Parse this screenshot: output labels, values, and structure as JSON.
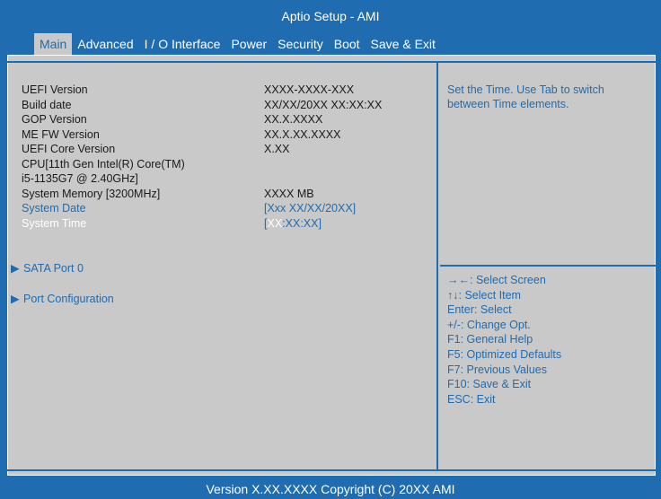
{
  "title": "Aptio Setup - AMI",
  "menu": [
    {
      "label": "Main",
      "active": true
    },
    {
      "label": "Advanced",
      "active": false
    },
    {
      "label": "I / O Interface",
      "active": false
    },
    {
      "label": "Power",
      "active": false
    },
    {
      "label": "Security",
      "active": false
    },
    {
      "label": "Boot",
      "active": false
    },
    {
      "label": "Save & Exit",
      "active": false
    }
  ],
  "info": {
    "uefi_version": {
      "label": "UEFI Version",
      "value": "XXXX-XXXX-XXX"
    },
    "build_date": {
      "label": "Build date",
      "value": "XX/XX/20XX XX:XX:XX"
    },
    "gop_version": {
      "label": "GOP Version",
      "value": "XX.X.XXXX"
    },
    "me_fw_version": {
      "label": "ME FW Version",
      "value": "XX.X.XX.XXXX"
    },
    "uefi_core_version": {
      "label": "UEFI Core Version",
      "value": "X.XX"
    },
    "cpu_line1": "CPU[11th Gen Intel(R) Core(TM)",
    "cpu_line2": "i5-1135G7 @ 2.40GHz]",
    "system_memory": {
      "label": "System Memory [3200MHz]",
      "value": "XXXX MB"
    },
    "system_date": {
      "label": "System Date",
      "value": "[Xxx XX/XX/20XX]"
    },
    "system_time": {
      "label": "System Time",
      "value_open": "[",
      "value_selected": "XX",
      "value_rest": ":XX:XX]"
    }
  },
  "submenus": [
    {
      "label": "SATA Port 0",
      "arrow": "▶"
    },
    {
      "label": "Port Configuration",
      "arrow": "▶"
    }
  ],
  "help": "Set the Time. Use Tab to switch between Time elements.",
  "keys": [
    {
      "key": "→←",
      "desc": ": Select Screen"
    },
    {
      "key": "↑↓",
      "desc": ": Select Item"
    },
    {
      "key": "Enter",
      "desc": ": Select"
    },
    {
      "key": "+/-",
      "desc": ": Change Opt."
    },
    {
      "key": "F1",
      "desc": ": General Help"
    },
    {
      "key": "F5",
      "desc": ": Optimized Defaults"
    },
    {
      "key": "F7",
      "desc": ": Previous Values"
    },
    {
      "key": "F10",
      "desc": ": Save & Exit"
    },
    {
      "key": "ESC",
      "desc": ": Exit"
    }
  ],
  "footer": "Version X.XX.XXXX Copyright (C) 20XX AMI",
  "colors": {
    "blue": "#1f6cb0",
    "panel": "#c9c9c9",
    "text": "#1a1a1a",
    "white": "#ffffff"
  }
}
